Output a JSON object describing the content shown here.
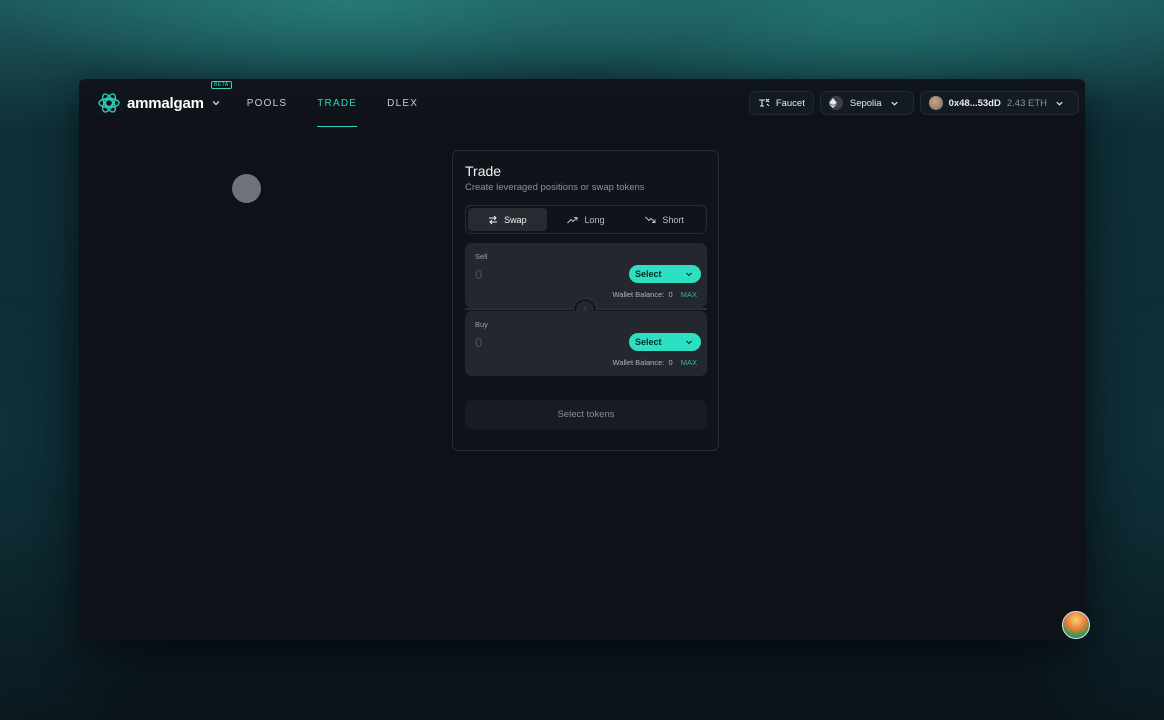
{
  "brand": {
    "name": "ammalgam",
    "badge": "BETA"
  },
  "nav": [
    {
      "label": "POOLS",
      "active": false
    },
    {
      "label": "TRADE",
      "active": true
    },
    {
      "label": "DLEX",
      "active": false
    }
  ],
  "header_actions": {
    "faucet": "Faucet",
    "network": "Sepolia",
    "wallet_address": "0x48...53dD",
    "wallet_balance": "2.43 ETH"
  },
  "trade": {
    "title": "Trade",
    "subtitle": "Create leveraged positions or swap tokens",
    "tabs": [
      {
        "label": "Swap",
        "active": true
      },
      {
        "label": "Long",
        "active": false
      },
      {
        "label": "Short",
        "active": false
      }
    ],
    "sell": {
      "label": "Sell",
      "placeholder": "0",
      "select_label": "Select",
      "balance_label": "Wallet Balance:",
      "balance_value": "0",
      "max_label": "MAX"
    },
    "buy": {
      "label": "Buy",
      "placeholder": "0",
      "select_label": "Select",
      "balance_label": "Wallet Balance:",
      "balance_value": "0",
      "max_label": "MAX"
    },
    "submit_label": "Select tokens"
  },
  "colors": {
    "accent": "#35d3bd",
    "select_button": "#2de0c3",
    "background": "#0e1117"
  }
}
